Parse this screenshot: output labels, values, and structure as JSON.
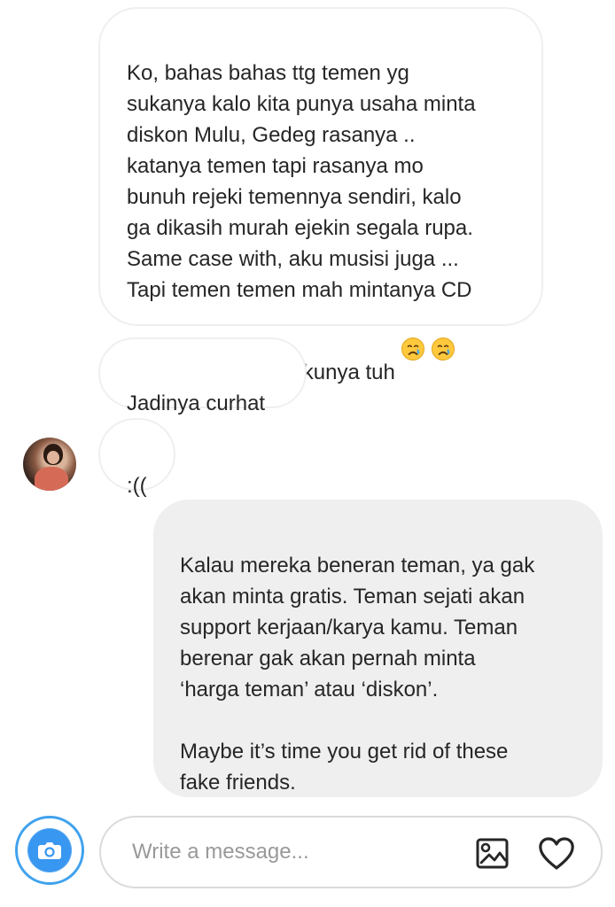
{
  "messages": [
    {
      "direction": "incoming",
      "text": "Ko, bahas bahas ttg temen yg\nsukanya kalo kita punya usaha minta\ndiskon Mulu, Gedeg rasanya ..\nkatanya temen tapi rasanya mo\nbunuh rejeki temennya sendiri, kalo\nga dikasih murah ejekin segala rupa.\nSame case with, aku musisi juga ...\nTapi temen temen mah mintanya CD\ngratisan :(( sedih akunya tuh",
      "trailing_emojis": [
        "crying-face-emoji",
        "crying-face-emoji"
      ]
    },
    {
      "direction": "incoming",
      "text": "Jadinya curhat"
    },
    {
      "direction": "incoming",
      "text": ":(("
    },
    {
      "direction": "outgoing",
      "text": "Kalau mereka beneran teman, ya gak\nakan minta gratis. Teman sejati akan\nsupport kerjaan/karya kamu. Teman\nberenar gak akan pernah minta\n‘harga teman’ atau ‘diskon’.\n\nMaybe it’s time you get rid of these\nfake friends."
    }
  ],
  "composer": {
    "placeholder": "Write a message..."
  },
  "icons": {
    "camera": "camera-icon",
    "gallery": "image-icon",
    "like": "heart-icon"
  },
  "colors": {
    "incoming_border": "#efefef",
    "outgoing_bg": "#efefef",
    "text": "#262626",
    "placeholder": "#999999",
    "camera_blue": "#3897f0",
    "composer_border": "#dbdbdb"
  }
}
